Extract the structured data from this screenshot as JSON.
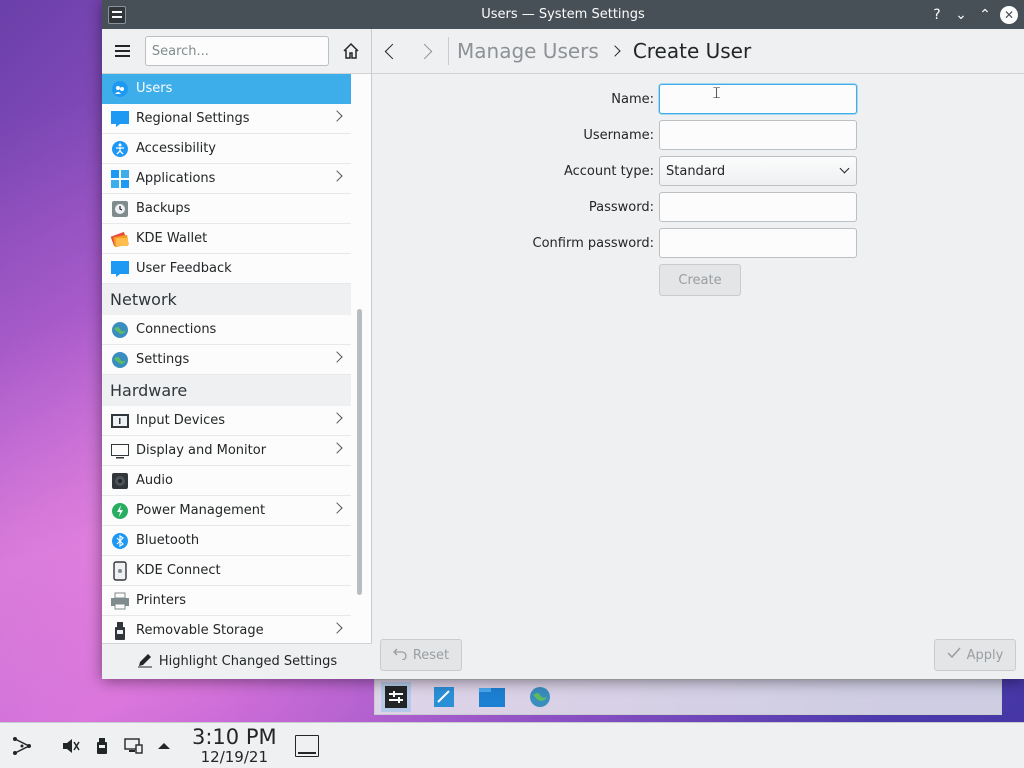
{
  "window": {
    "title": "Users — System Settings",
    "help_glyph": "?",
    "minimize_glyph": "⌄",
    "maximize_glyph": "⌃",
    "close_glyph": "✕"
  },
  "sidebar": {
    "search_placeholder": "Search...",
    "items": [
      {
        "label": "Users",
        "icon": "users-icon",
        "selected": true,
        "has_children": false
      },
      {
        "label": "Regional Settings",
        "icon": "regional-settings-icon",
        "has_children": true
      },
      {
        "label": "Accessibility",
        "icon": "accessibility-icon",
        "has_children": false
      },
      {
        "label": "Applications",
        "icon": "applications-icon",
        "has_children": true
      },
      {
        "label": "Backups",
        "icon": "backups-icon",
        "has_children": false
      },
      {
        "label": "KDE Wallet",
        "icon": "kde-wallet-icon",
        "has_children": false
      },
      {
        "label": "User Feedback",
        "icon": "user-feedback-icon",
        "has_children": false
      }
    ],
    "network_category": "Network",
    "network_items": [
      {
        "label": "Connections",
        "icon": "globe-icon",
        "has_children": false
      },
      {
        "label": "Settings",
        "icon": "globe-icon",
        "has_children": true
      }
    ],
    "hardware_category": "Hardware",
    "hardware_items": [
      {
        "label": "Input Devices",
        "icon": "keyboard-icon",
        "has_children": true
      },
      {
        "label": "Display and Monitor",
        "icon": "monitor-icon",
        "has_children": true
      },
      {
        "label": "Audio",
        "icon": "speaker-icon",
        "has_children": false
      },
      {
        "label": "Power Management",
        "icon": "power-icon",
        "has_children": true
      },
      {
        "label": "Bluetooth",
        "icon": "bluetooth-icon",
        "has_children": false
      },
      {
        "label": "KDE Connect",
        "icon": "phone-icon",
        "has_children": false
      },
      {
        "label": "Printers",
        "icon": "printer-icon",
        "has_children": false
      },
      {
        "label": "Removable Storage",
        "icon": "usb-icon",
        "has_children": true
      }
    ],
    "footer_label": "Highlight Changed Settings"
  },
  "main": {
    "breadcrumb_parent": "Manage Users",
    "breadcrumb_current": "Create User",
    "form": {
      "name_label": "Name:",
      "name_value": "",
      "username_label": "Username:",
      "username_value": "",
      "account_type_label": "Account type:",
      "account_type_value": "Standard",
      "password_label": "Password:",
      "password_value": "",
      "confirm_password_label": "Confirm password:",
      "confirm_password_value": "",
      "create_label": "Create"
    },
    "reset_label": "Reset",
    "apply_label": "Apply"
  },
  "panel": {
    "time": "3:10 PM",
    "date": "12/19/21"
  },
  "colors": {
    "accent": "#3daee9",
    "titlebar": "#475057",
    "window_bg": "#eff0f1"
  }
}
